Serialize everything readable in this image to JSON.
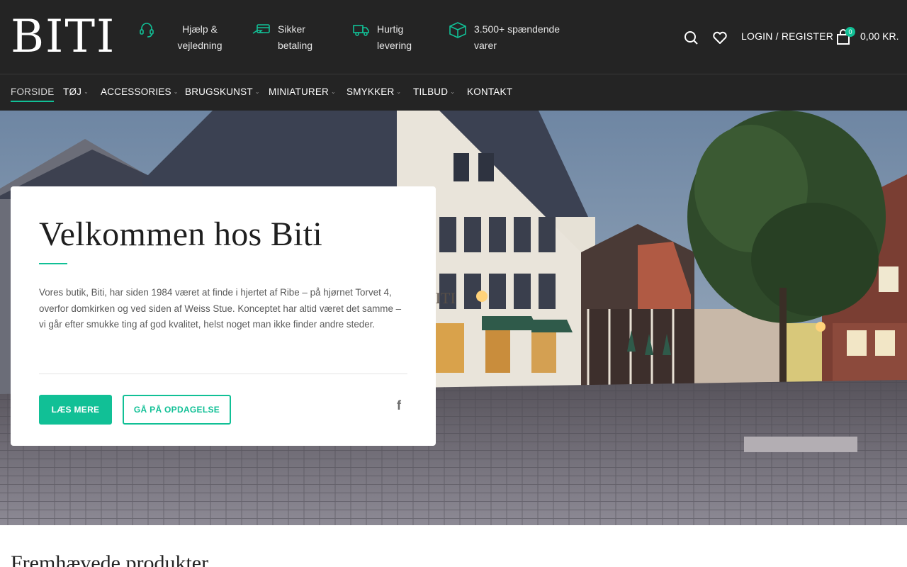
{
  "brand": {
    "logo_text": "BITI",
    "accent_color": "#11c096",
    "header_bg": "#242424"
  },
  "header": {
    "features": [
      {
        "icon": "headset-icon",
        "text": "Hjælp &\nvejledning"
      },
      {
        "icon": "card-payment-icon",
        "text": "Sikker\nbetaling"
      },
      {
        "icon": "delivery-truck-icon",
        "text": "Hurtig\nlevering"
      },
      {
        "icon": "package-box-icon",
        "text": "3.500+ spændende\nvarer"
      }
    ],
    "search_icon": "search-icon",
    "wishlist_icon": "heart-icon",
    "login_label": "LOGIN / REGISTER",
    "cart_icon": "shopping-bag-icon",
    "cart_count": "0",
    "cart_total": "0,00 KR."
  },
  "nav": {
    "items": [
      {
        "label": "FORSIDE",
        "has_dropdown": false,
        "active": true
      },
      {
        "label": "TØJ",
        "has_dropdown": true
      },
      {
        "label": "ACCESSORIES",
        "has_dropdown": true
      },
      {
        "label": "BRUGSKUNST",
        "has_dropdown": true
      },
      {
        "label": "MINIATURER",
        "has_dropdown": true
      },
      {
        "label": "SMYKKER",
        "has_dropdown": true
      },
      {
        "label": "TILBUD",
        "has_dropdown": true
      },
      {
        "label": "KONTAKT",
        "has_dropdown": false
      }
    ],
    "chevron": "⌄"
  },
  "hero": {
    "title": "Velkommen hos Biti",
    "body": "Vores butik, Biti, har siden 1984 været at finde i hjertet af Ribe – på hjørnet Torvet 4, overfor domkirken og ved siden af Weiss Stue. Konceptet har altid været det samme – vi går efter smukke ting af god kvalitet, helst noget man ikke finder andre steder.",
    "primary_button": "LÆS MERE",
    "secondary_button": "GÅ PÅ OPDAGELSE",
    "social_icon": "facebook-icon",
    "social_glyph": "f",
    "shop_sign": "BITI"
  },
  "featured": {
    "title": "Fremhævede produkter"
  }
}
